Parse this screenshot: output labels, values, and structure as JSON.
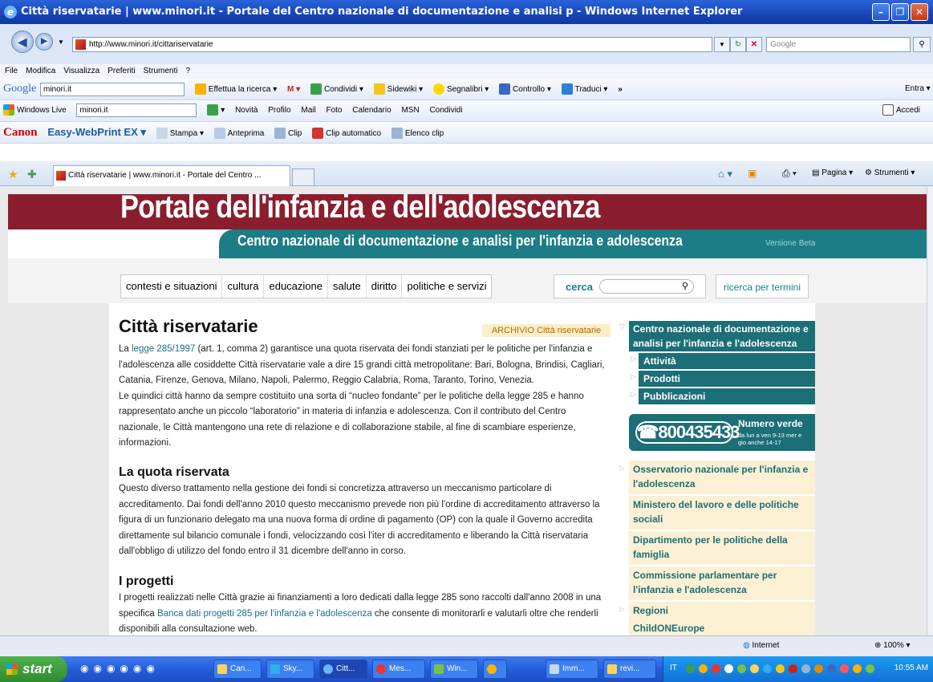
{
  "window": {
    "title": "Città riservatarie | www.minori.it - Portale del Centro nazionale di documentazione e analisi p - Windows Internet Explorer"
  },
  "address": {
    "url": "http://www.minori.it/cittariservatarie",
    "search_placeholder": "Google"
  },
  "menu": [
    "File",
    "Modifica",
    "Visualizza",
    "Preferiti",
    "Strumenti",
    "?"
  ],
  "google_toolbar": {
    "logo": "Google",
    "query": "minori.it",
    "items": [
      "Effettua la ricerca",
      "Condividi",
      "Sidewiki",
      "Segnalibri",
      "Controllo",
      "Traduci",
      "»"
    ],
    "right": "Entra"
  },
  "live_toolbar": {
    "label": "Windows Live",
    "query": "minori.it",
    "items": [
      "Novità",
      "Profilo",
      "Mail",
      "Foto",
      "Calendario",
      "MSN",
      "Condividi"
    ],
    "right": "Accedi"
  },
  "canon_toolbar": {
    "brand": "Canon",
    "product": "Easy-WebPrint EX",
    "items": [
      "Stampa",
      "Anteprima",
      "Clip",
      "Clip automatico",
      "Elenco clip"
    ]
  },
  "tabs": {
    "active": "Città riservatarie | www.minori.it - Portale del Centro ...",
    "commands": [
      "Pagina",
      "Strumenti"
    ]
  },
  "page": {
    "site_title": "Portale dell'infanzia e dell'adolescenza",
    "subtitle": "Centro nazionale di documentazione e analisi per l'infanzia e adolescenza",
    "version": "Versione Beta",
    "nav": [
      "contesti e situazioni",
      "cultura",
      "educazione",
      "salute",
      "diritto",
      "politiche e servizi"
    ],
    "search_label": "cerca",
    "search_terms": "ricerca per termini",
    "heading": "Città riservatarie",
    "archive": "ARCHIVIO Città riservatarie",
    "intro_prefix": "La ",
    "intro_link": "legge 285/1997",
    "intro_rest": " (art. 1, comma 2) garantisce una quota riservata dei fondi stanziati per le politiche per l'infanzia e l'adolescenza alle cosiddette Città riservatarie vale a dire 15 grandi città metropolitane: Bari, Bologna, Brindisi, Cagliari, Catania, Firenze, Genova, Milano, Napoli, Palermo, Reggio Calabria, Roma, Taranto, Torino, Venezia.",
    "para2": "Le quindici città hanno da sempre costituito una sorta di “nucleo fondante” per le politiche della legge 285 e hanno rappresentato anche un piccolo “laboratorio” in materia di infanzia e adolescenza. Con il contributo del Centro nazionale, le Città mantengono una rete di relazione e di collaborazione stabile, al fine di scambiare esperienze, informazioni.",
    "h_quota": "La quota riservata",
    "para3": "Questo diverso trattamento nella gestione dei fondi si concretizza attraverso un meccanismo particolare di accreditamento. Dai fondi dell'anno 2010 questo meccanismo prevede non più l'ordine di accreditamento attraverso la figura di un funzionario delegato ma una nuova forma di ordine di pagamento (OP) con la quale il Governo accredita direttamente sul bilancio comunale i fondi, velocizzando così l'iter di accreditamento e liberando la Città riservataria dall'obbligo di utilizzo del fondo entro il 31 dicembre dell'anno in corso.",
    "h_progetti": "I progetti",
    "para4_prefix": "I progetti realizzati nelle Città grazie ai finanziamenti a loro dedicati dalla legge 285 sono raccolti dall'anno 2008 in una specifica ",
    "para4_link": "Banca dati progetti 285 per l'infanzia e l'adolescenza",
    "para4_rest": " che consente di monitorarli e valutarli oltre che renderli disponibili alla consultazione web."
  },
  "sidebar": {
    "head": "Centro nazionale di documentazione e analisi per l'infanzia e l'adolescenza",
    "subs": [
      "Attività",
      "Prodotti",
      "Pubblicazioni"
    ],
    "phone": "800435433",
    "phone_label": "Numero verde",
    "phone_hours": "da lun a ven 9-13 mer e gio anche 14-17",
    "links": [
      "Osservatorio nazionale per l'infanzia e l'adolescenza",
      "Ministero del lavoro e delle politiche sociali",
      "Dipartimento per le politiche della famiglia",
      "Commissione parlamentare per l'infanzia e l'adolescenza",
      "Regioni",
      "ChildONEurope"
    ]
  },
  "status": {
    "zone": "Internet",
    "zoom": "100%"
  },
  "taskbar": {
    "start": "start",
    "tasks": [
      "Can...",
      "Sky...",
      "Citt...",
      "Mes...",
      "Win...",
      "Imm...",
      "revi..."
    ],
    "lang": "IT",
    "clock": "10:55 AM"
  },
  "colors": {
    "banner_red": "#8a1e2f",
    "teal": "#1c6e77",
    "xp_blue": "#245ddb"
  }
}
